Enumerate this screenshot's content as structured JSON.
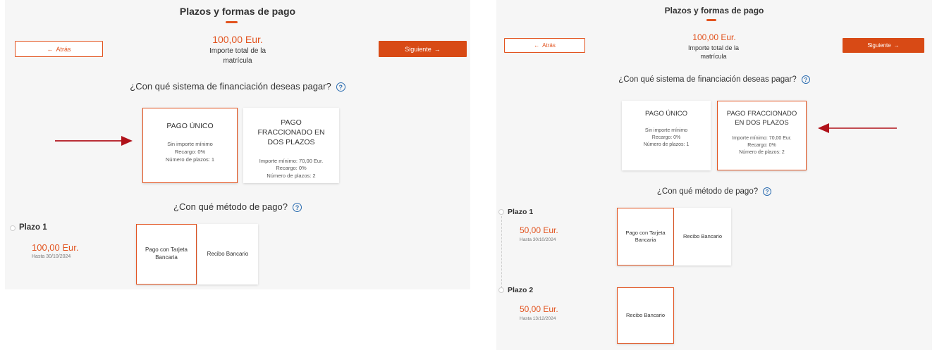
{
  "left": {
    "title": "Plazos y formas de pago",
    "amount": "100,00 Eur.",
    "amount_label": "Importe total de la matrícula",
    "back_label": "Atrás",
    "next_label": "Siguiente",
    "question_system": "¿Con qué sistema de financiación deseas pagar?",
    "help": "?",
    "options": [
      {
        "title": "PAGO ÚNICO",
        "line1": "Sin importe mínimo",
        "line2": "Recargo: 0%",
        "line3": "Número de plazos: 1"
      },
      {
        "title": "PAGO FRACCIONADO EN DOS PLAZOS",
        "line1": "Importe mínimo: 70,00 Eur.",
        "line2": "Recargo: 0%",
        "line3": "Número de plazos: 2"
      }
    ],
    "question_method": "¿Con qué método de pago?",
    "plazos": [
      {
        "label": "Plazo 1",
        "amount": "100,00 Eur.",
        "date": "Hasta 30/10/2024",
        "methods": [
          "Pago con Tarjeta Bancaria",
          "Recibo Bancario"
        ]
      }
    ]
  },
  "right": {
    "title": "Plazos y formas de pago",
    "amount": "100,00 Eur.",
    "amount_label": "Importe total de la matrícula",
    "back_label": "Atrás",
    "next_label": "Siguiente",
    "question_system": "¿Con qué sistema de financiación deseas pagar?",
    "help": "?",
    "options": [
      {
        "title": "PAGO ÚNICO",
        "line1": "Sin importe mínimo",
        "line2": "Recargo: 0%",
        "line3": "Número de plazos: 1"
      },
      {
        "title": "PAGO FRACCIONADO EN DOS PLAZOS",
        "line1": "Importe mínimo: 70,00 Eur.",
        "line2": "Recargo: 0%",
        "line3": "Número de plazos: 2"
      }
    ],
    "question_method": "¿Con qué método de pago?",
    "plazos": [
      {
        "label": "Plazo 1",
        "amount": "50,00 Eur.",
        "date": "Hasta 30/10/2024",
        "methods": [
          "Pago con Tarjeta Bancaria",
          "Recibo Bancario"
        ]
      },
      {
        "label": "Plazo 2",
        "amount": "50,00 Eur.",
        "date": "Hasta 13/12/2024",
        "methods": [
          "Recibo Bancario"
        ]
      }
    ]
  },
  "colors": {
    "accent": "#e2531f",
    "button": "#d84a15",
    "annotation_arrow": "#b0121a",
    "help": "#2b6cb0"
  },
  "icons": {
    "back": "arrow-left-icon",
    "next": "arrow-right-icon",
    "help": "question-circle-icon"
  }
}
